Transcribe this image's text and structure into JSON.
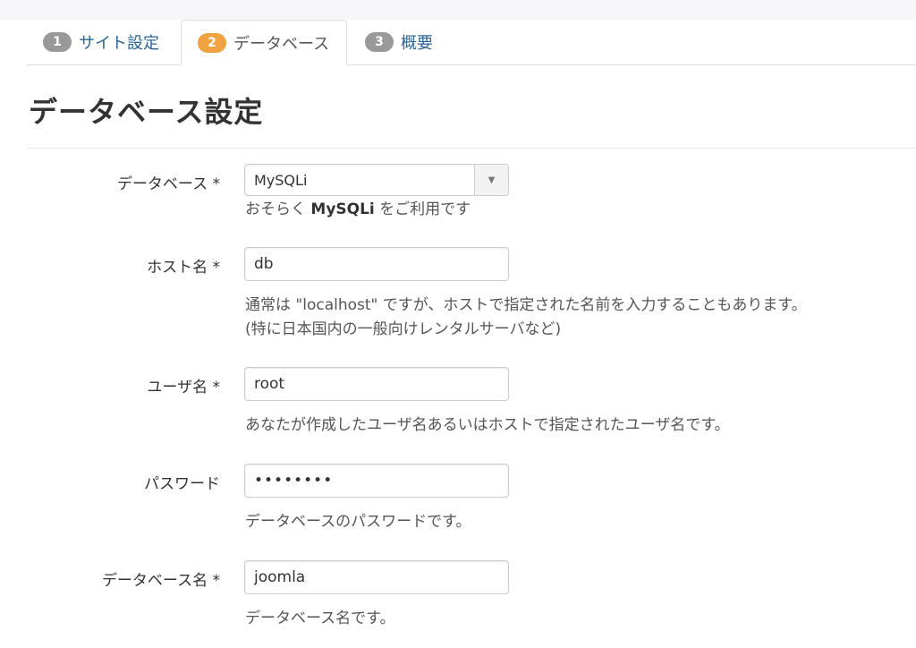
{
  "tabs": [
    {
      "number": "1",
      "label": "サイト設定",
      "active": false
    },
    {
      "number": "2",
      "label": "データベース",
      "active": true
    },
    {
      "number": "3",
      "label": "概要",
      "active": false
    }
  ],
  "page_title": "データベース設定",
  "form": {
    "db_type": {
      "label": "データベース *",
      "value": "MySQLi",
      "help_prefix": "おそらく ",
      "help_bold": "MySQLi",
      "help_suffix": " をご利用です"
    },
    "host": {
      "label": "ホスト名 *",
      "value": "db",
      "help_line1": "通常は \"localhost\" ですが、ホストで指定された名前を入力することもあります。",
      "help_line2": "(特に日本国内の一般向けレンタルサーバなど)"
    },
    "user": {
      "label": "ユーザ名 *",
      "value": "root",
      "help": "あなたが作成したユーザ名あるいはホストで指定されたユーザ名です。"
    },
    "password": {
      "label": "パスワード",
      "value": "••••••••",
      "help": "データベースのパスワードです。"
    },
    "db_name": {
      "label": "データベース名 *",
      "value": "joomla",
      "help": "データベース名です。"
    }
  },
  "colors": {
    "active_badge": "#f0a340",
    "inactive_badge": "#999999",
    "link": "#2a6496"
  }
}
